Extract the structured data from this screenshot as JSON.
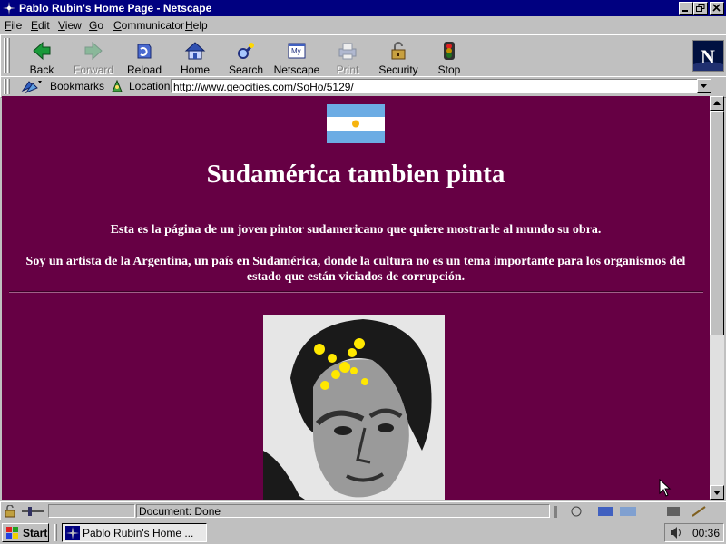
{
  "window": {
    "title": "Pablo Rubin's Home Page - Netscape"
  },
  "menu": [
    "File",
    "Edit",
    "View",
    "Go",
    "Communicator",
    "Help"
  ],
  "toolbar": {
    "buttons": [
      {
        "label": "Back",
        "icon": "back-arrow-icon",
        "enabled": true
      },
      {
        "label": "Forward",
        "icon": "forward-arrow-icon",
        "enabled": false
      },
      {
        "label": "Reload",
        "icon": "reload-icon",
        "enabled": true
      },
      {
        "label": "Home",
        "icon": "home-icon",
        "enabled": true
      },
      {
        "label": "Search",
        "icon": "search-icon",
        "enabled": true
      },
      {
        "label": "Netscape",
        "icon": "netscape-icon",
        "enabled": true
      },
      {
        "label": "Print",
        "icon": "print-icon",
        "enabled": false
      },
      {
        "label": "Security",
        "icon": "security-lock-icon",
        "enabled": true
      },
      {
        "label": "Stop",
        "icon": "stop-icon",
        "enabled": true
      }
    ]
  },
  "location_bar": {
    "bookmarks_label": "Bookmarks",
    "location_label": "Location:",
    "url": "http://www.geocities.com/SoHo/5129/"
  },
  "page": {
    "heading": "Sudamérica tambien pinta",
    "intro1": "Esta es la página de un joven pintor sudamericano que quiere mostrarle al mundo su obra.",
    "intro2": "Soy un artista de la Argentina, un país en Sudamérica, donde la cultura no es un tema importante para los organismos del estado que están viciados de corrupción.",
    "background_color": "#660044",
    "text_color": "#ffffff"
  },
  "status": {
    "text": "Document: Done"
  },
  "taskbar": {
    "start_label": "Start",
    "task_label": "Pablo Rubin's Home ...",
    "clock": "00:36"
  }
}
